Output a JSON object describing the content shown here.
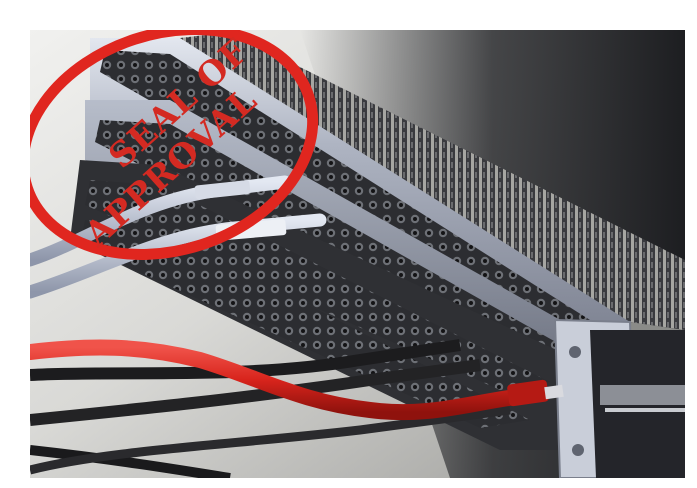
{
  "photo": {
    "subject": "patch-bay",
    "colors": {
      "background_light": "#e6e6e4",
      "background_dark": "#2a2b2e",
      "panel_face": "#9ea4b2",
      "panel_highlight": "#d3d8e4",
      "jack_field": "#2c2d31",
      "red_cable": "#d8241c",
      "gray_cable": "#a9b1c4",
      "black_cable": "#1c1c1e"
    }
  },
  "seal": {
    "line1": "SEAL OF",
    "line2": "APPROVAL",
    "color": "#e0261f"
  }
}
